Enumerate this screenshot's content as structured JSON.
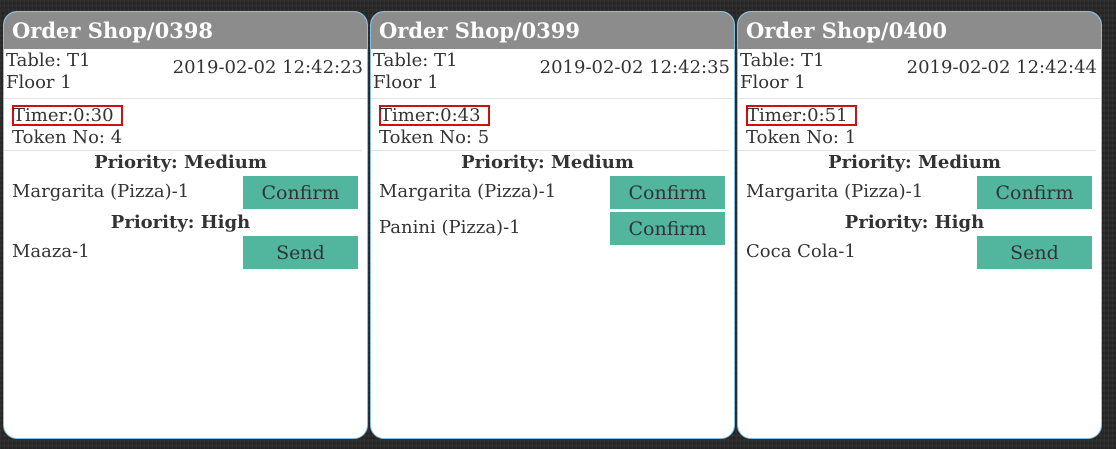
{
  "orders": [
    {
      "title": "Order Shop/0398",
      "table": "Table: T1",
      "floor": "Floor 1",
      "timestamp": "2019-02-02 12:42:23",
      "timer": "Timer:0:30",
      "token": "Token No: 4",
      "groups": [
        {
          "priority": "Priority: Medium",
          "items": [
            {
              "name": "Margarita (Pizza)-1",
              "action": "Confirm"
            }
          ]
        },
        {
          "priority": "Priority: High",
          "items": [
            {
              "name": "Maaza-1",
              "action": "Send"
            }
          ]
        }
      ]
    },
    {
      "title": "Order Shop/0399",
      "table": "Table: T1",
      "floor": "Floor 1",
      "timestamp": "2019-02-02 12:42:35",
      "timer": "Timer:0:43",
      "token": "Token No: 5",
      "groups": [
        {
          "priority": "Priority: Medium",
          "items": [
            {
              "name": "Margarita (Pizza)-1",
              "action": "Confirm"
            },
            {
              "name": "Panini (Pizza)-1",
              "action": "Confirm"
            }
          ]
        }
      ]
    },
    {
      "title": "Order Shop/0400",
      "table": "Table: T1",
      "floor": "Floor 1",
      "timestamp": "2019-02-02 12:42:44",
      "timer": "Timer:0:51",
      "token": "Token No: 1",
      "groups": [
        {
          "priority": "Priority: Medium",
          "items": [
            {
              "name": "Margarita (Pizza)-1",
              "action": "Confirm"
            }
          ]
        },
        {
          "priority": "Priority: High",
          "items": [
            {
              "name": "Coca Cola-1",
              "action": "Send"
            }
          ]
        }
      ]
    }
  ],
  "colors": {
    "header_bg": "#8c8c8c",
    "button_bg": "#52b59e",
    "timer_border": "#d01010",
    "card_border": "#7fc4e8"
  }
}
